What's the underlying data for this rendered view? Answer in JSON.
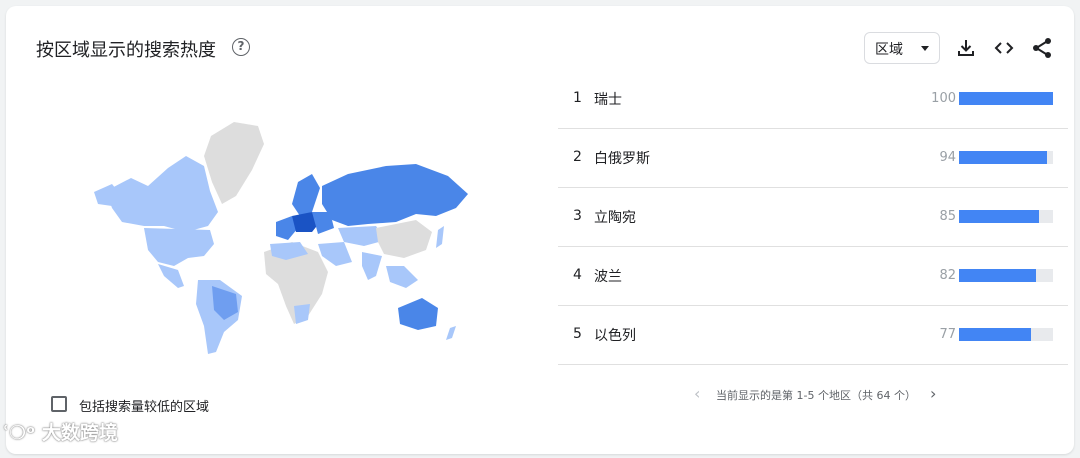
{
  "header": {
    "title": "按区域显示的搜索热度",
    "help_icon": "question-circle-icon"
  },
  "toolbar": {
    "resolution_select": "区域",
    "download_icon": "download-icon",
    "embed_icon": "code-icon",
    "share_icon": "share-icon"
  },
  "map": {
    "type": "choropleth",
    "colors": {
      "max": "#1a53c4",
      "high": "#4a86e8",
      "mid": "#6f9ef0",
      "low": "#a8c7fa",
      "none": "#dddddd"
    }
  },
  "ranking": {
    "rows": [
      {
        "rank": "1",
        "name": "瑞士",
        "value": 100
      },
      {
        "rank": "2",
        "name": "白俄罗斯",
        "value": 94
      },
      {
        "rank": "3",
        "name": "立陶宛",
        "value": 85
      },
      {
        "rank": "4",
        "name": "波兰",
        "value": 82
      },
      {
        "rank": "5",
        "name": "以色列",
        "value": 77
      }
    ],
    "bar_color": "#4285f4"
  },
  "pagination": {
    "text": "当前显示的是第 1-5 个地区（共 64 个）",
    "prev_icon": "chevron-left-icon",
    "next_icon": "chevron-right-icon"
  },
  "options": {
    "low_volume_label": "包括搜索量较低的区域",
    "low_volume_checked": false
  },
  "watermark": {
    "text": "大数跨境"
  }
}
